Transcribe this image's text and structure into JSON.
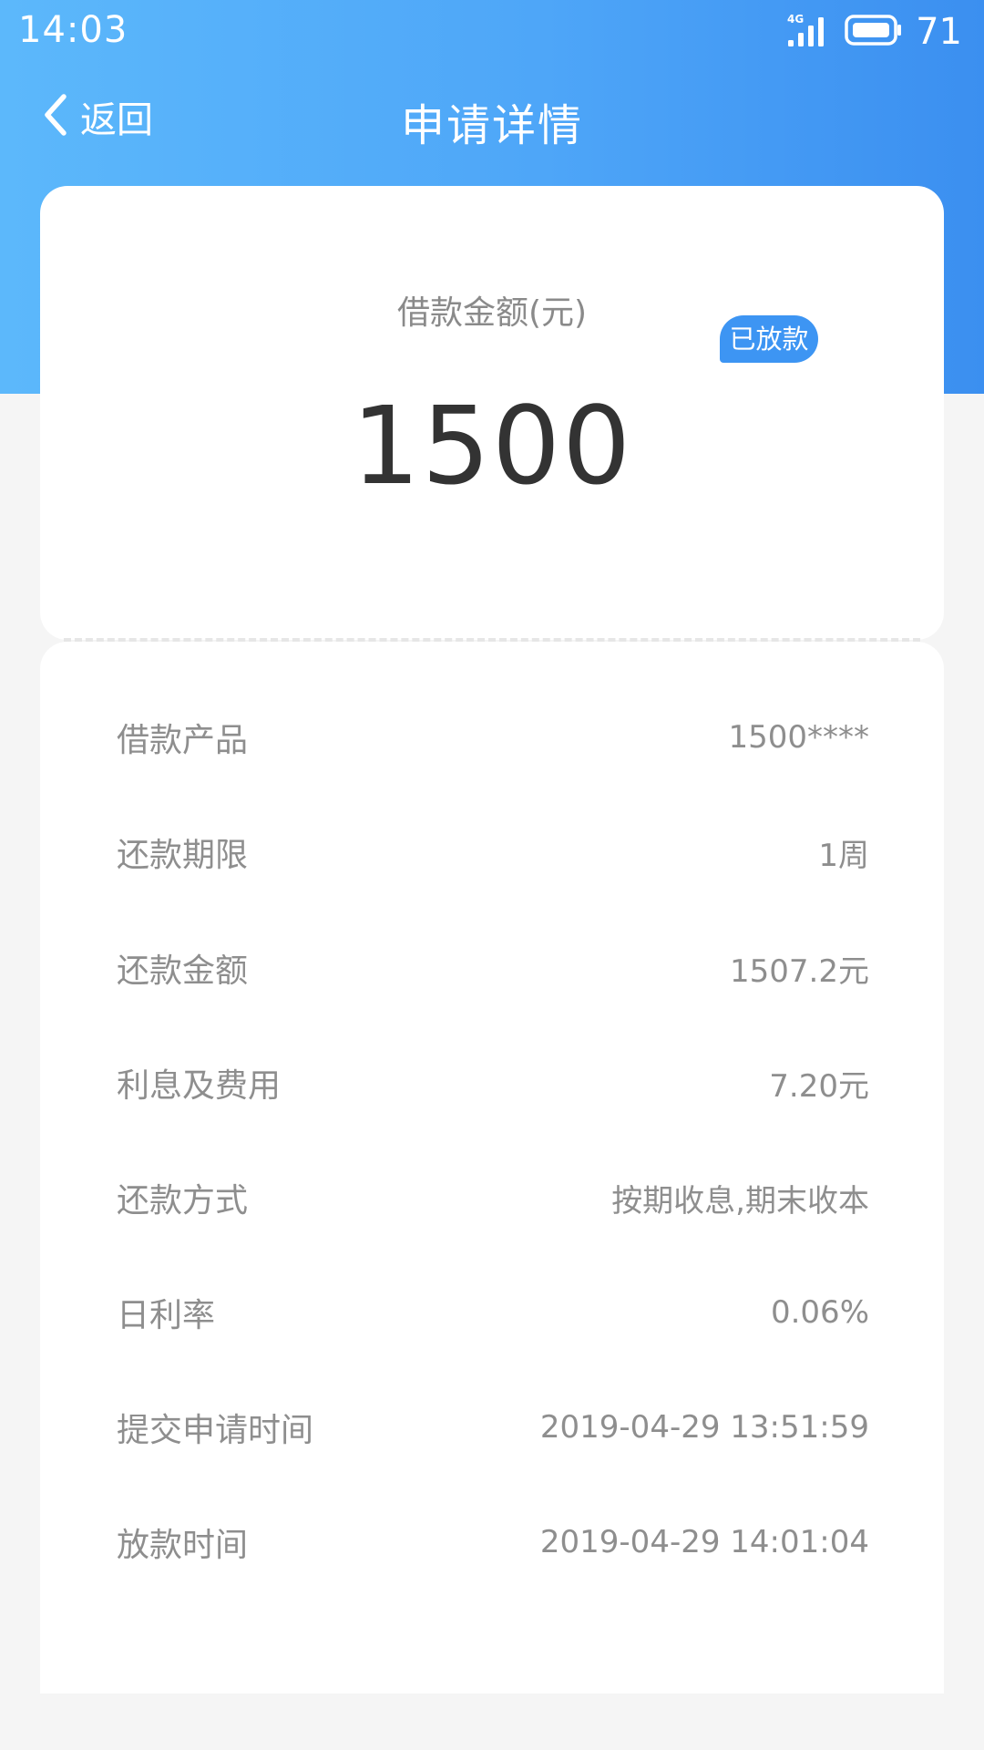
{
  "status_bar": {
    "time": "14:03",
    "network": "4G",
    "battery": "71",
    "icons": [
      "signal-icon",
      "battery-icon"
    ]
  },
  "nav": {
    "back_label": "返回",
    "title": "申请详情",
    "icons": [
      "chevron-left-icon"
    ]
  },
  "summary": {
    "amount_label": "借款金额(元)",
    "amount": "1500",
    "status_badge": "已放款"
  },
  "details": [
    {
      "label": "借款产品",
      "value": "1500****"
    },
    {
      "label": "还款期限",
      "value": "1周"
    },
    {
      "label": "还款金额",
      "value": "1507.2元"
    },
    {
      "label": "利息及费用",
      "value": "7.20元"
    },
    {
      "label": "还款方式",
      "value": "按期收息,期末收本"
    },
    {
      "label": "日利率",
      "value": "0.06%"
    },
    {
      "label": "提交申请时间",
      "value": "2019-04-29 13:51:59"
    },
    {
      "label": "放款时间",
      "value": "2019-04-29 14:01:04"
    }
  ],
  "colors": {
    "header_gradient_start": "#5cb8fb",
    "header_gradient_end": "#3b8ff0",
    "badge": "#3d95f3",
    "amount_text": "#333333",
    "muted_text": "#8e8e8e",
    "page_background": "#f5f5f5"
  }
}
